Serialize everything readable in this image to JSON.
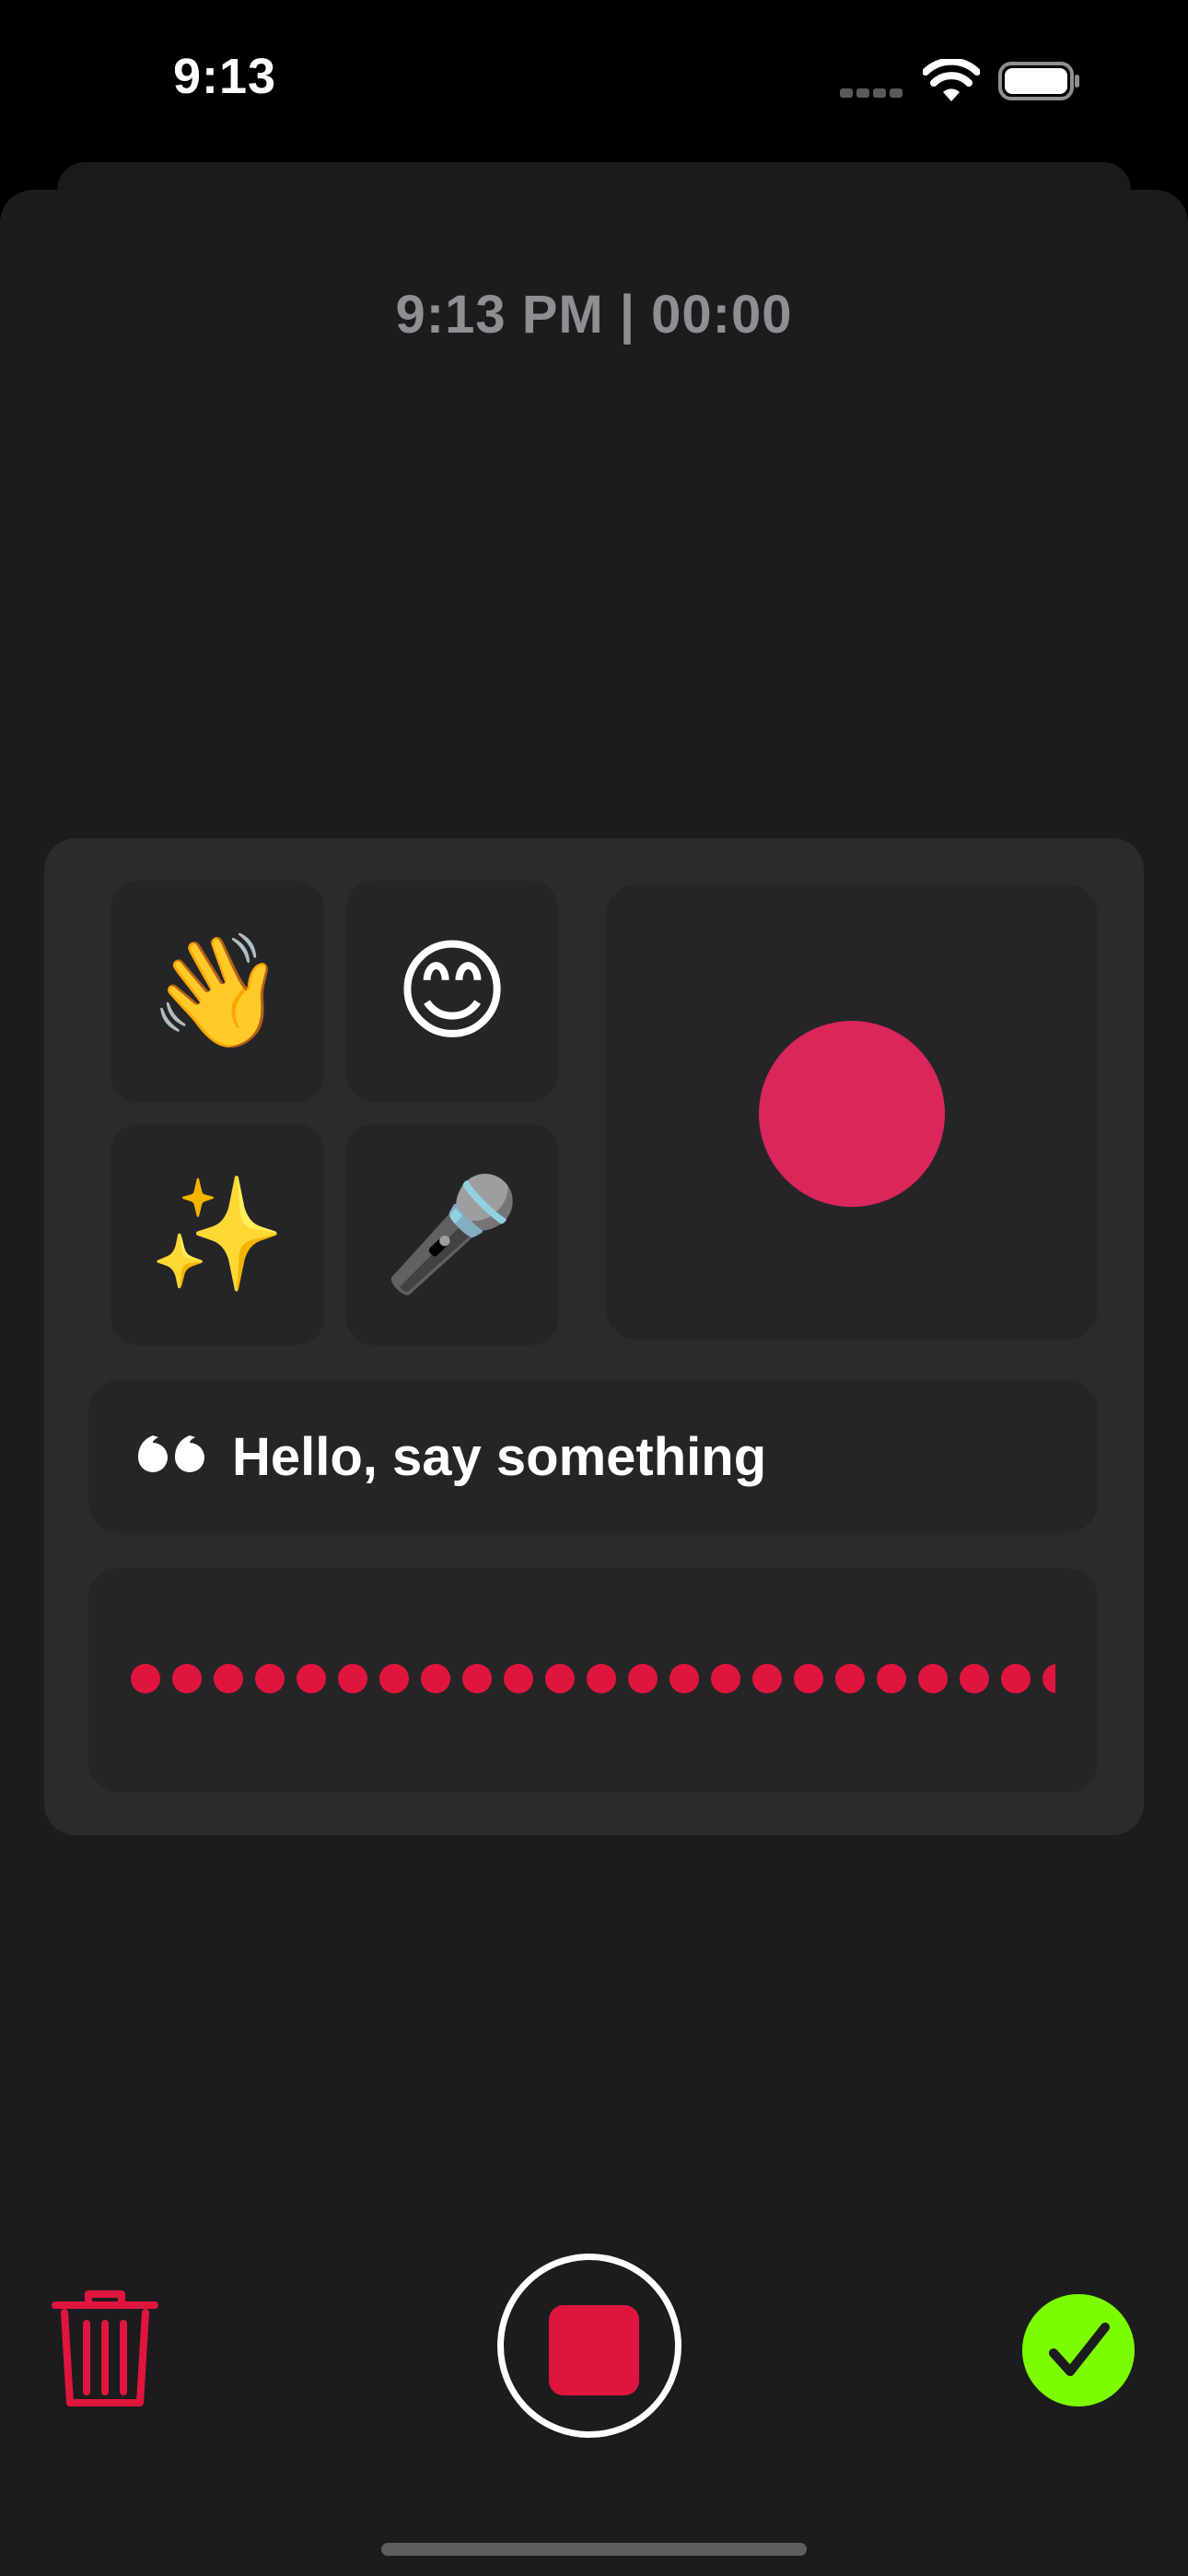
{
  "status_bar": {
    "time": "9:13",
    "icons": [
      "cellular-icon",
      "wifi-icon",
      "battery-icon"
    ]
  },
  "recording": {
    "timestamp": "9:13 PM | 00:00",
    "emoji_tiles": [
      {
        "emoji": "👋",
        "name": "waving-hand"
      },
      {
        "emoji": "😊",
        "name": "smiling-face"
      },
      {
        "emoji": "✨",
        "name": "sparkles"
      },
      {
        "emoji": "🎤",
        "name": "microphone"
      }
    ],
    "prompt_text": "Hello, say something",
    "waveform_dot_count": 23
  },
  "colors": {
    "background": "#1c1c1e",
    "card": "#2b2b2d",
    "tile": "#252527",
    "record_red": "#e0153e",
    "record_pink": "#d9265b",
    "confirm_green": "#7cfc00",
    "muted_text": "#8e8e93"
  },
  "controls": {
    "delete": "trash-icon",
    "record": "stop-icon",
    "confirm": "checkmark-icon"
  }
}
